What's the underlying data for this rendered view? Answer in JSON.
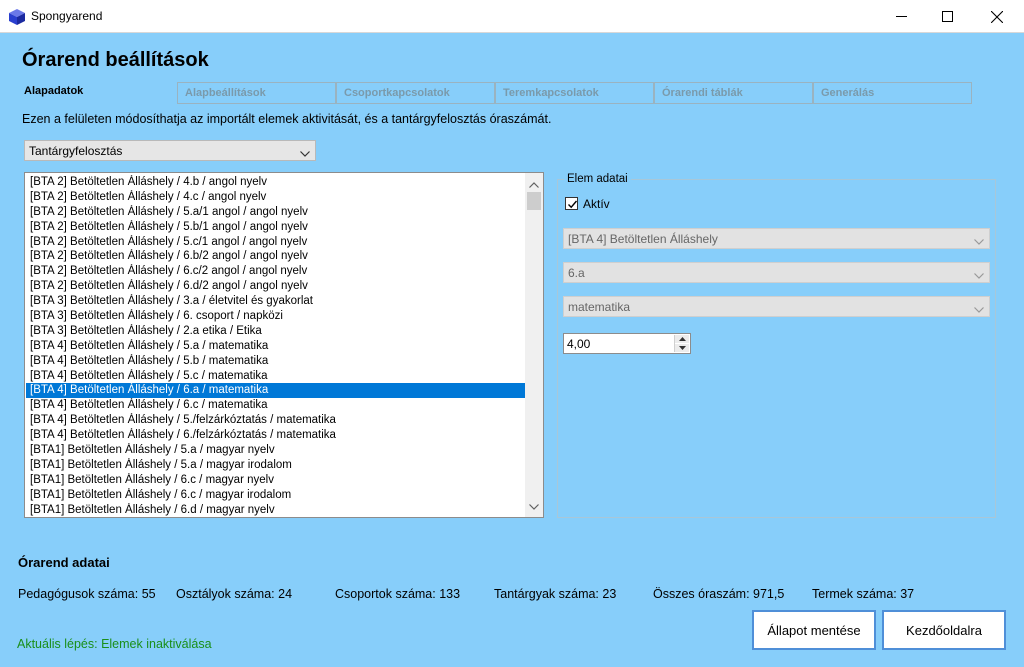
{
  "window": {
    "title": "Spongyarend"
  },
  "colors": {
    "background": "#87cefa",
    "selection": "#0078d7",
    "status": "#1a8f1a",
    "button_border": "#4f8fd8"
  },
  "page": {
    "title": "Órarend beállítások",
    "description": "Ezen a felületen módosíthatja az importált elemek aktivitását, és a tantárgyfelosztás óraszámát."
  },
  "tabs": {
    "active": "Alapadatok",
    "items": [
      "Alapbeállítások",
      "Csoportkapcsolatok",
      "Teremkapcsolatok",
      "Órarendi táblák",
      "Generálás"
    ]
  },
  "main_select": {
    "value": "Tantárgyfelosztás"
  },
  "list": {
    "items": [
      "[BTA 2] Betöltetlen Álláshely / 4.b / angol nyelv",
      "[BTA 2] Betöltetlen Álláshely / 4.c / angol nyelv",
      "[BTA 2] Betöltetlen Álláshely / 5.a/1 angol / angol nyelv",
      "[BTA 2] Betöltetlen Álláshely / 5.b/1 angol / angol nyelv",
      "[BTA 2] Betöltetlen Álláshely / 5.c/1 angol / angol nyelv",
      "[BTA 2] Betöltetlen Álláshely / 6.b/2 angol / angol nyelv",
      "[BTA 2] Betöltetlen Álláshely / 6.c/2 angol / angol nyelv",
      "[BTA 2] Betöltetlen Álláshely / 6.d/2 angol / angol nyelv",
      "[BTA 3] Betöltetlen Álláshely / 3.a / életvitel és gyakorlat",
      "[BTA 3] Betöltetlen Álláshely / 6. csoport / napközi",
      "[BTA 3] Betöltetlen Álláshely / 2.a etika / Etika",
      "[BTA 4] Betöltetlen Álláshely / 5.a / matematika",
      "[BTA 4] Betöltetlen Álláshely / 5.b / matematika",
      "[BTA 4] Betöltetlen Álláshely / 5.c / matematika",
      "[BTA 4] Betöltetlen Álláshely / 6.a / matematika",
      "[BTA 4] Betöltetlen Álláshely / 6.c / matematika",
      "[BTA 4] Betöltetlen Álláshely / 5./felzárkóztatás / matematika",
      "[BTA 4] Betöltetlen Álláshely / 6./felzárkóztatás / matematika",
      "[BTA1] Betöltetlen Álláshely / 5.a / magyar nyelv",
      "[BTA1] Betöltetlen Álláshely / 5.a / magyar irodalom",
      "[BTA1] Betöltetlen Álláshely / 6.c / magyar nyelv",
      "[BTA1] Betöltetlen Álláshely / 6.c / magyar irodalom",
      "[BTA1] Betöltetlen Álláshely / 6.d / magyar nyelv"
    ],
    "selected_index": 14
  },
  "element": {
    "legend": "Elem adatai",
    "active_label": "Aktív",
    "active_checked": true,
    "teacher": "[BTA 4] Betöltetlen Álláshely",
    "class": "6.a",
    "subject": "matematika",
    "hours": "4,00"
  },
  "timetable": {
    "title": "Órarend adatai",
    "stats": [
      "Pedagógusok száma: 55",
      "Osztályok száma: 24",
      "Csoportok száma: 133",
      "Tantárgyak száma: 23",
      "Összes óraszám: 971,5",
      "Termek száma: 37"
    ]
  },
  "status": {
    "text": "Aktuális lépés: Elemek inaktiválása"
  },
  "buttons": {
    "save": "Állapot mentése",
    "home": "Kezdőoldalra"
  },
  "icons": {
    "app": "cube-icon",
    "minimize": "minimize-icon",
    "maximize": "maximize-icon",
    "close": "close-icon",
    "dropdown": "chevron-down-icon",
    "check": "checkmark-icon",
    "scroll_up": "arrow-up-icon",
    "scroll_down": "arrow-down-icon"
  }
}
